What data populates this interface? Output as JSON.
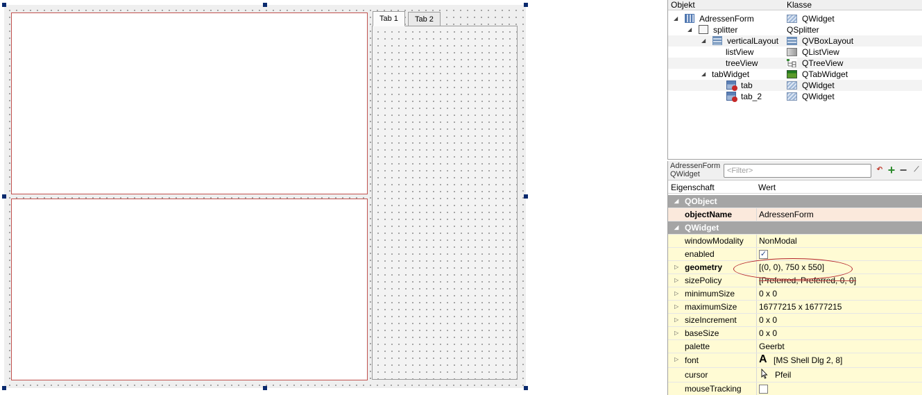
{
  "designer": {
    "tabs": [
      "Tab 1",
      "Tab 2"
    ]
  },
  "object_inspector": {
    "headers": {
      "object": "Objekt",
      "class": "Klasse"
    },
    "rows": [
      {
        "name": "AdressenForm",
        "class": "QWidget",
        "icon": "form-icon",
        "class_icon": "widget-icon"
      },
      {
        "name": "splitter",
        "class": "QSplitter",
        "icon": "splitter-icon",
        "class_icon": ""
      },
      {
        "name": "verticalLayout",
        "class": "QVBoxLayout",
        "icon": "vbox-layout-icon",
        "class_icon": "vbox-layout-icon"
      },
      {
        "name": "listView",
        "class": "QListView",
        "icon": "",
        "class_icon": "list-view-icon"
      },
      {
        "name": "treeView",
        "class": "QTreeView",
        "icon": "",
        "class_icon": "tree-view-icon"
      },
      {
        "name": "tabWidget",
        "class": "QTabWidget",
        "icon": "",
        "class_icon": "tab-widget-icon"
      },
      {
        "name": "tab",
        "class": "QWidget",
        "icon": "tab-page-icon",
        "class_icon": "widget-icon"
      },
      {
        "name": "tab_2",
        "class": "QWidget",
        "icon": "tab-page-icon",
        "class_icon": "widget-icon"
      }
    ]
  },
  "property_editor": {
    "context_name": "AdressenForm",
    "context_class": "QWidget",
    "filter_placeholder": "<Filter>",
    "headers": {
      "property": "Eigenschaft",
      "value": "Wert"
    },
    "groups": {
      "qobject": "QObject",
      "qwidget": "QWidget"
    },
    "rows": {
      "objectName": {
        "name": "objectName",
        "value": "AdressenForm"
      },
      "windowModality": {
        "name": "windowModality",
        "value": "NonModal"
      },
      "enabled": {
        "name": "enabled",
        "checked": true
      },
      "geometry": {
        "name": "geometry",
        "value": "[(0, 0), 750 x 550]"
      },
      "sizePolicy": {
        "name": "sizePolicy",
        "value": "[Preferred, Preferred, 0, 0]"
      },
      "minimumSize": {
        "name": "minimumSize",
        "value": "0 x 0"
      },
      "maximumSize": {
        "name": "maximumSize",
        "value": "16777215 x 16777215"
      },
      "sizeIncrement": {
        "name": "sizeIncrement",
        "value": "0 x 0"
      },
      "baseSize": {
        "name": "baseSize",
        "value": "0 x 0"
      },
      "palette": {
        "name": "palette",
        "value": "Geerbt"
      },
      "font": {
        "name": "font",
        "value": "[MS Shell Dlg 2, 8]",
        "icon_glyph": "A"
      },
      "cursor": {
        "name": "cursor",
        "value": "Pfeil"
      },
      "mouseTracking": {
        "name": "mouseTracking",
        "checked": false
      }
    }
  },
  "colors": {
    "selection_border": "#c0504d",
    "group_row": "#a5a5a5",
    "qobject_row": "#fbe9dc",
    "qwidget_row": "#fffbd4",
    "annotation_ellipse": "#b4232a"
  }
}
